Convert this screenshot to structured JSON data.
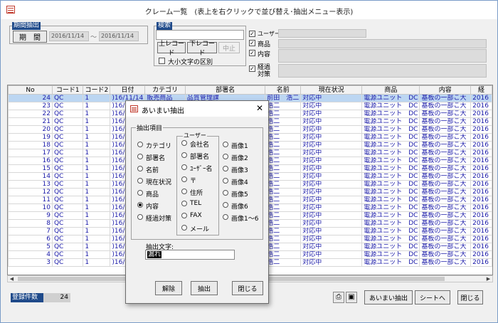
{
  "window": {
    "title": "クレーム一覧　(表上を右クリックで並び替え･抽出メニュー表示)"
  },
  "period": {
    "group_label": "期間抽出",
    "button_label": "期　間",
    "from": "2016/11/14",
    "sep": "～",
    "to": "2016/11/14"
  },
  "search": {
    "group_label": "検索",
    "input_value": "",
    "prev_label": "上レコード",
    "next_label": "下レコード",
    "stop_label": "中止",
    "case_label": "大小文字の区別",
    "case_checked": false
  },
  "filters": [
    {
      "label": "ユーザー",
      "checked": true
    },
    {
      "label": "商品",
      "checked": true
    },
    {
      "label": "内容",
      "checked": true
    },
    {
      "label": "経過\n対策",
      "checked": true
    }
  ],
  "grid": {
    "columns": [
      "No",
      "コード1",
      "コード2",
      "日付",
      "カテゴリ",
      "部署名",
      "名前",
      "現在状況",
      "商品",
      "内容",
      "経"
    ],
    "rows": [
      [
        "24",
        "QC",
        "1",
        ")16/11/14",
        "販売商品",
        "品質管理課",
        "前田　浩二",
        "対応中",
        "電源ユニット　DC",
        "基板の一部こ大",
        "2016"
      ],
      [
        "23",
        "QC",
        "1",
        ")16/",
        "",
        "",
        "浩二",
        "対応中",
        "電源ユニット　DC",
        "基板の一部こ大",
        "2016"
      ],
      [
        "22",
        "QC",
        "1",
        ")16/",
        "",
        "",
        "浩二",
        "対応中",
        "電源ユニット　DC",
        "基板の一部こ大",
        "2016"
      ],
      [
        "21",
        "QC",
        "1",
        ")16/",
        "",
        "",
        "浩二",
        "対応中",
        "電源ユニット　DC",
        "基板の一部こ大",
        "2016"
      ],
      [
        "20",
        "QC",
        "1",
        ")16/",
        "",
        "",
        "浩二",
        "対応中",
        "電源ユニット　DC",
        "基板の一部こ大",
        "2016"
      ],
      [
        "19",
        "QC",
        "1",
        ")16/",
        "",
        "",
        "浩二",
        "対応中",
        "電源ユニット　DC",
        "基板の一部こ大",
        "2016"
      ],
      [
        "18",
        "QC",
        "1",
        ")16/",
        "",
        "",
        "浩二",
        "対応中",
        "電源ユニット　DC",
        "基板の一部こ大",
        "2016"
      ],
      [
        "17",
        "QC",
        "1",
        ")16/",
        "",
        "",
        "浩二",
        "対応中",
        "電源ユニット　DC",
        "基板の一部こ大",
        "2016"
      ],
      [
        "16",
        "QC",
        "1",
        ")16/",
        "",
        "",
        "浩二",
        "対応中",
        "電源ユニット　DC",
        "基板の一部こ大",
        "2016"
      ],
      [
        "15",
        "QC",
        "1",
        ")16/",
        "",
        "",
        "浩二",
        "対応中",
        "電源ユニット　DC",
        "基板の一部こ大",
        "2016"
      ],
      [
        "14",
        "QC",
        "1",
        ")16/",
        "",
        "",
        "浩二",
        "対応中",
        "電源ユニット　DC",
        "基板の一部こ大",
        "2016"
      ],
      [
        "13",
        "QC",
        "1",
        ")16/",
        "",
        "",
        "浩二",
        "対応中",
        "電源ユニット　DC",
        "基板の一部こ大",
        "2016"
      ],
      [
        "12",
        "QC",
        "1",
        ")16/",
        "",
        "",
        "浩二",
        "対応中",
        "電源ユニット　DC",
        "基板の一部こ大",
        "2016"
      ],
      [
        "11",
        "QC",
        "1",
        ")16/",
        "",
        "",
        "浩二",
        "対応中",
        "電源ユニット　DC",
        "基板の一部こ大",
        "2016"
      ],
      [
        "10",
        "QC",
        "1",
        ")16/",
        "",
        "",
        "浩二",
        "対応中",
        "電源ユニット　DC",
        "基板の一部こ大",
        "2016"
      ],
      [
        "9",
        "QC",
        "1",
        ")16/",
        "",
        "",
        "浩二",
        "対応中",
        "電源ユニット　DC",
        "基板の一部こ大",
        "2016"
      ],
      [
        "8",
        "QC",
        "1",
        ")16/",
        "",
        "",
        "浩二",
        "対応中",
        "電源ユニット　DC",
        "基板の一部こ大",
        "2016"
      ],
      [
        "7",
        "QC",
        "1",
        ")16/",
        "",
        "",
        "浩二",
        "対応中",
        "電源ユニット　DC",
        "基板の一部こ大",
        "2016"
      ],
      [
        "6",
        "QC",
        "1",
        ")16/",
        "",
        "",
        "浩二",
        "対応中",
        "電源ユニット　DC",
        "基板の一部こ大",
        "2016"
      ],
      [
        "5",
        "QC",
        "1",
        ")16/",
        "",
        "",
        "浩二",
        "対応中",
        "電源ユニット　DC",
        "基板の一部こ大",
        "2016"
      ],
      [
        "4",
        "QC",
        "1",
        ")16/",
        "",
        "",
        "浩二",
        "対応中",
        "電源ユニット　DC",
        "基板の一部こ大",
        "2016"
      ],
      [
        "3",
        "QC",
        "1",
        ")16/",
        "",
        "",
        "浩二",
        "対応中",
        "電源ユニット　DC",
        "基板の一部こ大",
        "2016"
      ]
    ]
  },
  "footer": {
    "count_label": "登録件数",
    "count_value": "24",
    "fuzzy_button": "あいまい抽出",
    "sheet_button": "シートへ",
    "close_button": "閉じる"
  },
  "dialog": {
    "title": "あいまい抽出",
    "close_glyph": "✕",
    "group_label": "抽出項目",
    "user_group_label": "ユーザー",
    "col1": [
      {
        "label": "カテゴリ",
        "selected": false
      },
      {
        "label": "部署名",
        "selected": false
      },
      {
        "label": "名前",
        "selected": false
      },
      {
        "label": "現在状況",
        "selected": false
      },
      {
        "label": "商品",
        "selected": false
      },
      {
        "label": "内容",
        "selected": true
      },
      {
        "label": "経過対策",
        "selected": false
      }
    ],
    "col2": [
      {
        "label": "会社名",
        "selected": false
      },
      {
        "label": "部署名",
        "selected": false
      },
      {
        "label": "ﾕｰｻﾞｰ名",
        "selected": false
      },
      {
        "label": "〒",
        "selected": false
      },
      {
        "label": "住所",
        "selected": false
      },
      {
        "label": "TEL",
        "selected": false
      },
      {
        "label": "FAX",
        "selected": false
      },
      {
        "label": "メール",
        "selected": false
      }
    ],
    "col3": [
      {
        "label": "画像1",
        "selected": false
      },
      {
        "label": "画像2",
        "selected": false
      },
      {
        "label": "画像3",
        "selected": false
      },
      {
        "label": "画像4",
        "selected": false
      },
      {
        "label": "画像5",
        "selected": false
      },
      {
        "label": "画像6",
        "selected": false
      },
      {
        "label": "画像1～6",
        "selected": false
      }
    ],
    "text_label": "抽出文字:",
    "text_value": "漏れ",
    "clear_button": "解除",
    "extract_button": "抽出",
    "close_button": "閉じる"
  },
  "colors": {
    "group_label_bg": "#1f4a8a",
    "selected_row": "#bcd6f2",
    "data_text": "#1a1aa8"
  }
}
